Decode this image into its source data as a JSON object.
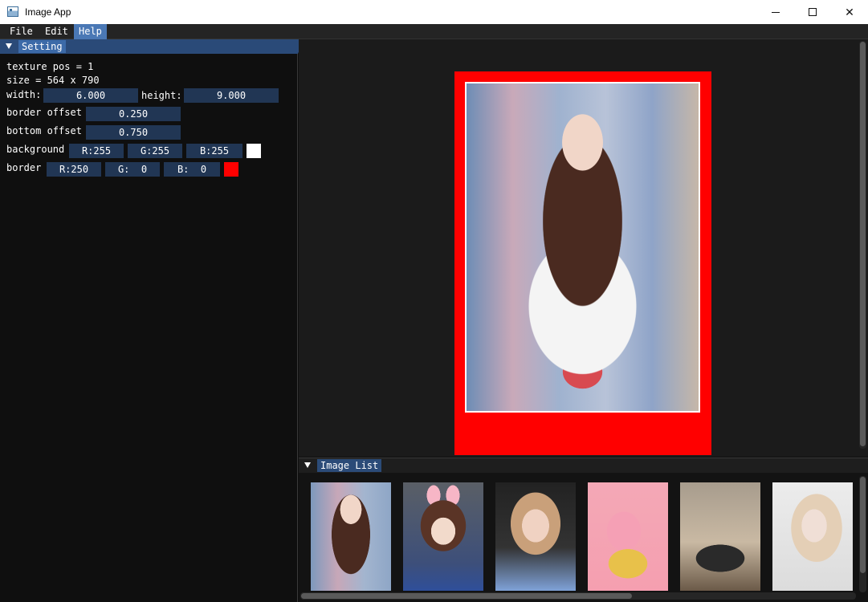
{
  "window": {
    "title": "Image App",
    "minimize_label": "—",
    "maximize_label": "□",
    "close_label": "✕"
  },
  "menu": [
    "File",
    "Edit",
    "Help"
  ],
  "setting": {
    "title": "Setting",
    "texture_pos": "texture pos = 1",
    "size": "size = 564 x 790",
    "width_label": "width:",
    "width_value": "6.000",
    "height_label": "height:",
    "height_value": "9.000",
    "border_offset_label": "border offset",
    "border_offset_value": "0.250",
    "bottom_offset_label": "bottom offset",
    "bottom_offset_value": "0.750",
    "background_label": "background",
    "background_r": "R:255",
    "background_g": "G:255",
    "background_b": "B:255",
    "background_color": "#ffffff",
    "border_label": "border",
    "border_r": "R:250",
    "border_g": "G:  0",
    "border_b": "B:  0",
    "border_color": "#ff0000"
  },
  "image_list": {
    "title": "Image List",
    "thumbnails": [
      {
        "name": "thumb-1",
        "style": "radial-gradient(ellipse 22px 30px at 50% 25%, #f1d6c8 0 60%, transparent 61%), radial-gradient(ellipse 34px 70px at 50% 48%, #4a2a20 0 70%, transparent 71%), linear-gradient(90deg,#7d99bd,#c7a7b8,#a3b5cf,#8ea6c6)"
      },
      {
        "name": "thumb-2",
        "style": "radial-gradient(ellipse 25px 28px at 50% 45%, #f2dacb 0 60%, transparent 61%), radial-gradient(ellipse 40px 45px at 50% 40%, #5a3426 0 70%, transparent 71%), radial-gradient(ellipse 12px 18px at 38% 12%, #f7b6c6 0 70%, transparent 71%), radial-gradient(ellipse 12px 18px at 62% 12%, #f7b6c6 0 70%, transparent 71%), linear-gradient(180deg,#5a5f66 0%,#3d4f7a 75%,#2f4f9a 100%)"
      },
      {
        "name": "thumb-3",
        "style": "radial-gradient(ellipse 28px 34px at 50% 40%, #f0d2c2 0 60%, transparent 61%), radial-gradient(ellipse 44px 55px at 50% 38%, #c9a07a 0 70%, transparent 71%), linear-gradient(180deg,#222 0%,#333 60%,#7fa2d8 100%)"
      },
      {
        "name": "thumb-4",
        "style": "radial-gradient(ellipse 40px 30px at 50% 75%, #e8c14a 0 60%, transparent 61%), radial-gradient(ellipse 35px 40px at 45% 45%, #f5a0b5 0 60%, transparent 61%), linear-gradient(180deg,#f4a8b6 0%,#f59fb0 100%)"
      },
      {
        "name": "thumb-5",
        "style": "radial-gradient(ellipse 50px 28px at 50% 70%, #2a2a2a 0 60%, transparent 61%), linear-gradient(180deg,#a79c8d 0%,#c9b9a3 55%,#6b5a48 100%)"
      },
      {
        "name": "thumb-6",
        "style": "radial-gradient(ellipse 26px 34px at 52% 40%, #f0dfd6 0 60%, transparent 61%), radial-gradient(ellipse 45px 60px at 55% 42%, #e4cfb6 0 70%, transparent 71%), linear-gradient(180deg,#ececec,#dcdcdc)"
      }
    ]
  }
}
